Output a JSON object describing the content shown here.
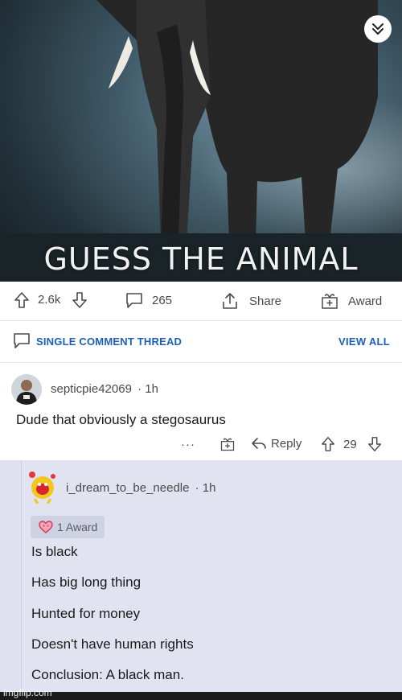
{
  "post": {
    "caption": "GUESS THE ANIMAL",
    "collapse_icon": "chevron-double-down-icon"
  },
  "actions": {
    "upvotes": "2.6k",
    "comments": "265",
    "share_label": "Share",
    "award_label": "Award"
  },
  "thread": {
    "title": "SINGLE COMMENT THREAD",
    "view_all": "VIEW ALL"
  },
  "comment": {
    "username": "septicpie42069",
    "age": "· 1h",
    "body": "Dude that obviously a stegosaurus",
    "more": "···",
    "reply_label": "Reply",
    "score": "29"
  },
  "reply": {
    "username": "i_dream_to_be_needle",
    "age": "· 1h",
    "award_chip": "1 Award",
    "lines": [
      "Is black",
      "Has big long thing",
      "Hunted for money",
      "Doesn't have human rights",
      "Conclusion: A black man."
    ]
  },
  "watermark": "imgflip.com",
  "colors": {
    "link_blue": "#1c5fb8",
    "reply_bg": "#e1e3f0",
    "text": "#1a1a1b"
  }
}
